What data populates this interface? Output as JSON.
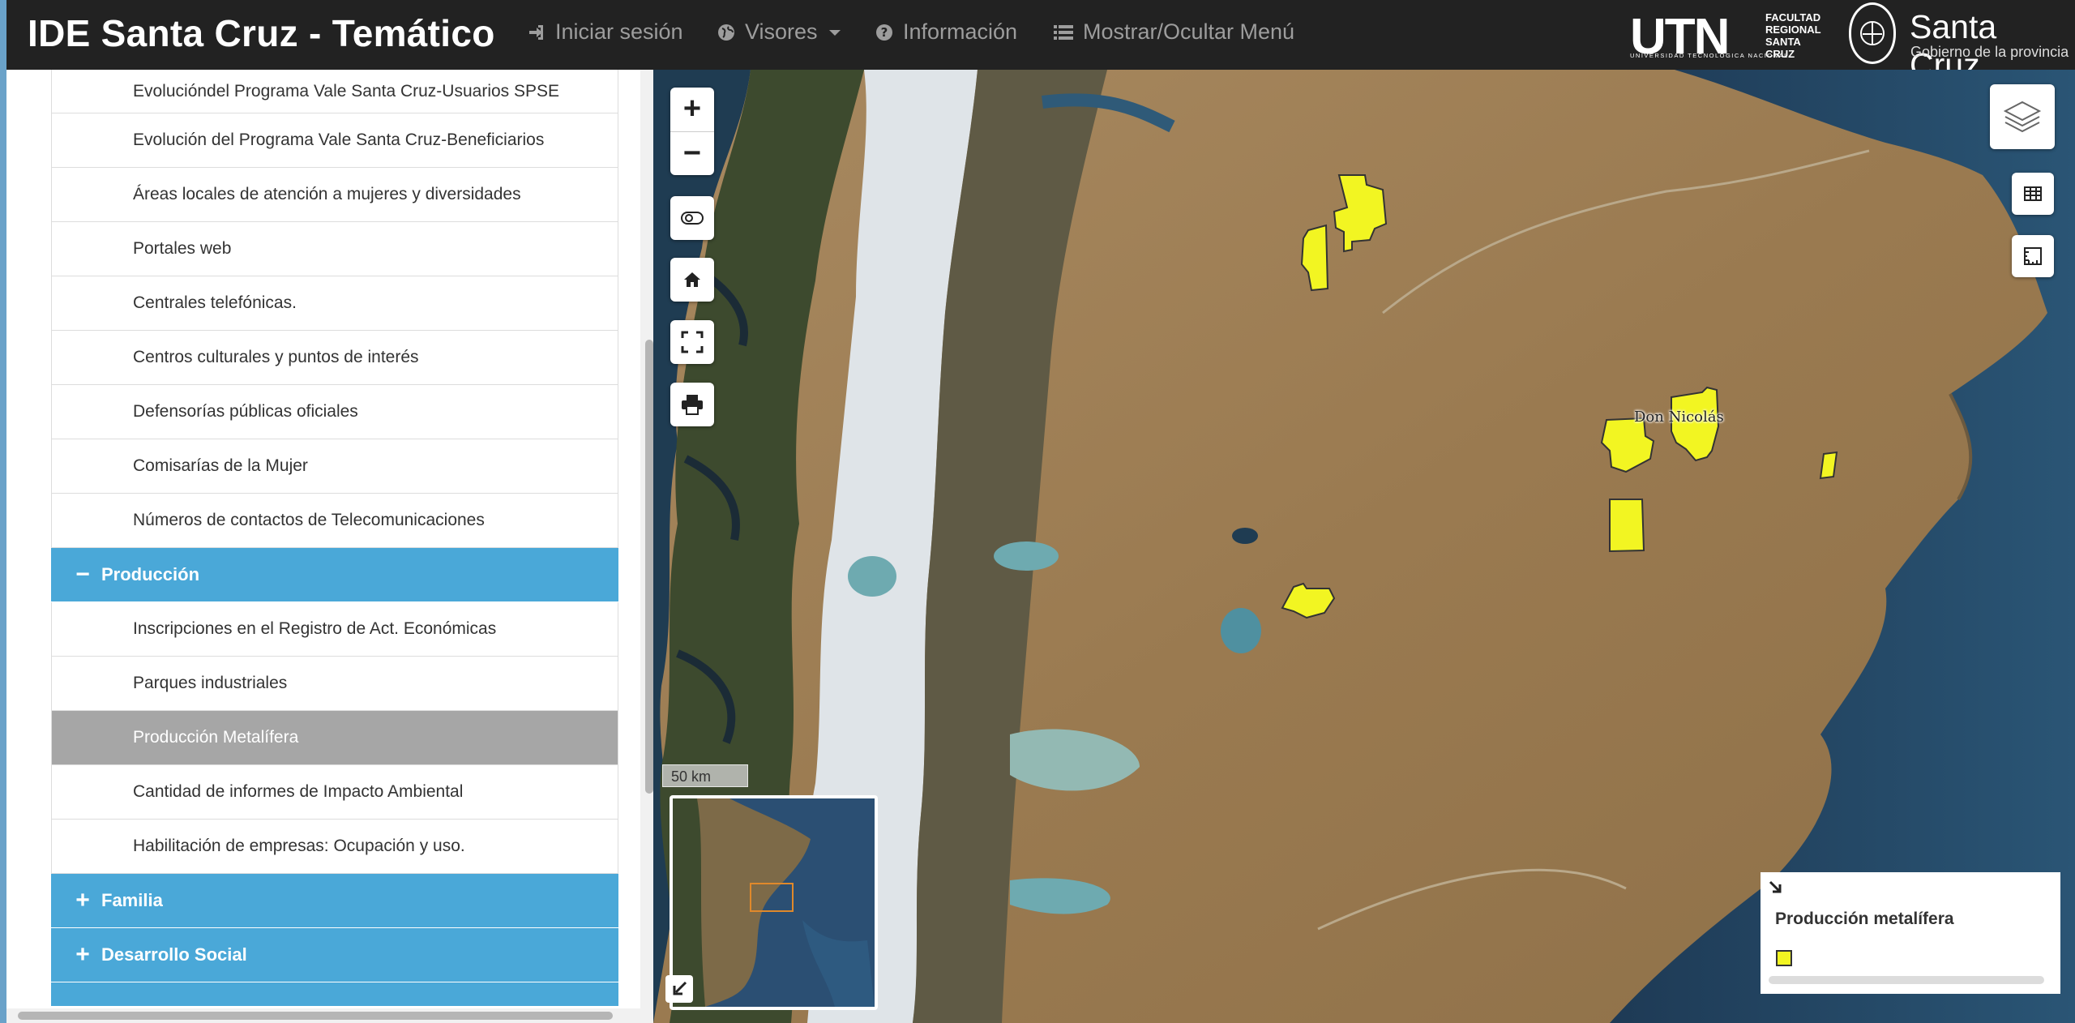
{
  "navbar": {
    "brand": "IDE Santa Cruz - Temático",
    "login": "Iniciar sesión",
    "viewers": "Visores",
    "info": "Información",
    "toggle_menu": "Mostrar/Ocultar Menú",
    "icons": [
      "sign-in-icon",
      "globe-icon",
      "question-circle-icon",
      "list-icon"
    ]
  },
  "logos": {
    "utn_main": "UTN",
    "utn_faculty_line1": "FACULTAD",
    "utn_faculty_line2": "REGIONAL",
    "utn_faculty_line3": "SANTA CRUZ",
    "utn_sub": "UNIVERSIDAD TECNOLÓGICA NACIONAL",
    "sc_title": "Santa Cruz",
    "sc_sub": "Gobierno de la provincia"
  },
  "sidebar": {
    "items_top": [
      "Evolucióndel Programa Vale Santa Cruz-Usuarios SPSE",
      "Evolución del Programa Vale Santa Cruz-Beneficiarios",
      "Áreas locales de atención a mujeres y diversidades",
      "Portales web",
      "Centrales telefónicas.",
      "Centros culturales y puntos de interés",
      "Defensorías públicas oficiales",
      "Comisarías de la Mujer",
      "Números de contactos de Telecomunicaciones"
    ],
    "category_produccion": {
      "sign": "−",
      "label": "Producción"
    },
    "items_produccion": [
      "Inscripciones en el Registro de Act. Económicas",
      "Parques industriales",
      "Producción Metalífera",
      "Cantidad de informes de Impacto Ambiental",
      "Habilitación de empresas: Ocupación y uso."
    ],
    "active_item": "Producción Metalífera",
    "category_familia": {
      "sign": "+",
      "label": "Familia"
    },
    "category_desarrollo": {
      "sign": "+",
      "label": "Desarrollo Social"
    }
  },
  "map": {
    "zoom_in": "+",
    "zoom_out": "−",
    "scale": "50 km",
    "place_label": "Don Nicolás",
    "legend_title": "Producción metalífera",
    "legend_color": "#f2f522",
    "controls": [
      "toggle-icon",
      "home-icon",
      "fullscreen-icon",
      "print-icon",
      "layers-icon",
      "table-icon",
      "measure-icon",
      "overview-collapse-icon",
      "legend-expand-icon"
    ]
  },
  "colors": {
    "navbar_bg": "#222222",
    "category_bg": "#4aa8d8",
    "active_item_bg": "#a6a6a6",
    "polygon_fill": "#f2f522"
  }
}
